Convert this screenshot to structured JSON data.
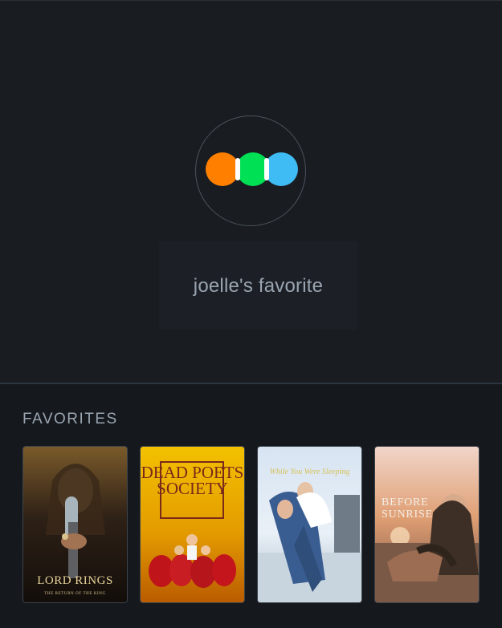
{
  "profile": {
    "username": "joelle's favorite",
    "logo_colors": [
      "#ff8000",
      "#00e054",
      "#40bcf4"
    ]
  },
  "favorites": {
    "title": "FAVORITES",
    "films": [
      {
        "title": "The Lord of the Rings: The Return of the King",
        "poster_text": "LORD RINGS",
        "poster_subtext": "THE RETURN OF THE KING"
      },
      {
        "title": "Dead Poets Society",
        "poster_text": "DEAD POETS SOCIETY"
      },
      {
        "title": "While You Were Sleeping",
        "poster_text": "While You Were Sleeping"
      },
      {
        "title": "Before Sunrise",
        "poster_text": "BEFORE SUNRISE"
      }
    ]
  }
}
